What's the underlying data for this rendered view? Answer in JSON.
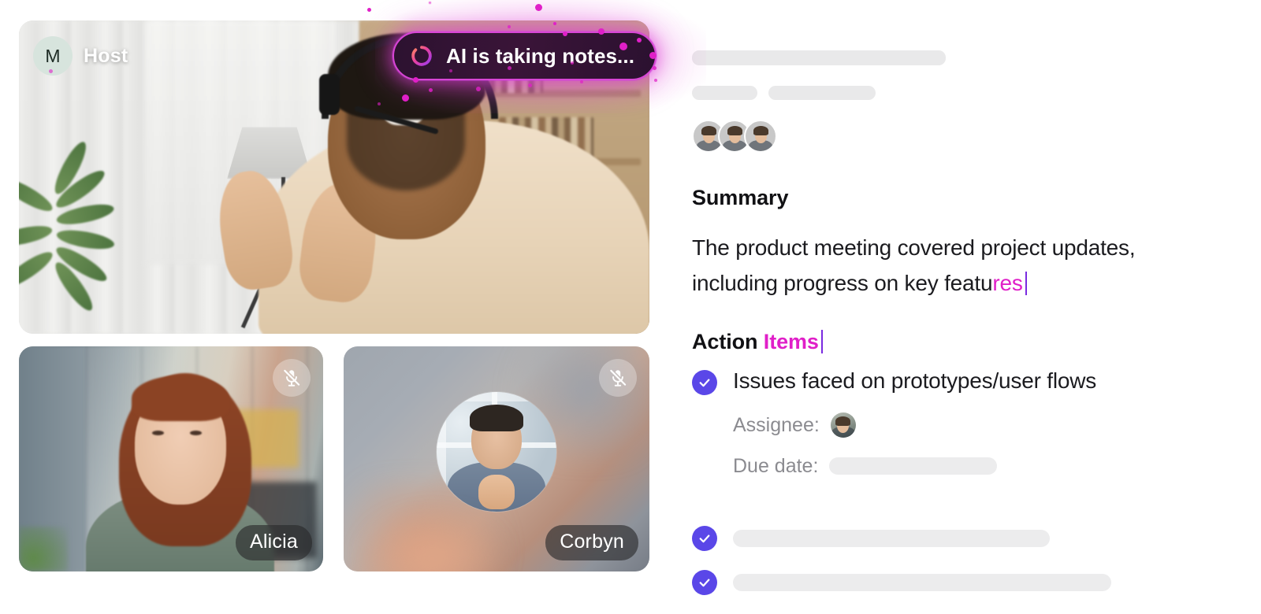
{
  "meeting": {
    "host_badge": {
      "initial": "M",
      "label": "Host"
    },
    "ai_status": {
      "text": "AI is taking notes...",
      "icon": "spinner-icon",
      "accent_color": "#d946d6",
      "glow_color": "#e01fc8"
    },
    "participants": [
      {
        "name": "Host",
        "tile": "main",
        "muted": false
      },
      {
        "name": "Alicia",
        "tile": "small-left",
        "muted": true,
        "mic_icon": "mic-muted-icon"
      },
      {
        "name": "Corbyn",
        "tile": "small-right",
        "muted": true,
        "mic_icon": "mic-muted-icon"
      }
    ]
  },
  "notes": {
    "attendee_avatars": [
      "attendee-1",
      "attendee-2",
      "attendee-3"
    ],
    "summary": {
      "heading": "Summary",
      "text_typed": "The product meeting covered project updates, including progress on key featu",
      "text_generating": "res",
      "caret": "|"
    },
    "action_items": {
      "heading_typed": "Action ",
      "heading_generating": "Items",
      "items": [
        {
          "text": "Issues faced on prototypes/user flows",
          "checked": true,
          "assignee_label": "Assignee:",
          "assignee_avatar": "assignee-avatar",
          "due_date_label": "Due date:",
          "due_date_value": ""
        },
        {
          "text": "",
          "checked": true
        },
        {
          "text": "",
          "checked": true
        }
      ]
    }
  },
  "theme": {
    "check_color": "#5a47e8",
    "ai_magenta": "#e01fc8",
    "skeleton_gray": "#e9e9ea",
    "text_primary": "#1b1b1f",
    "text_muted": "#8b8b90"
  }
}
